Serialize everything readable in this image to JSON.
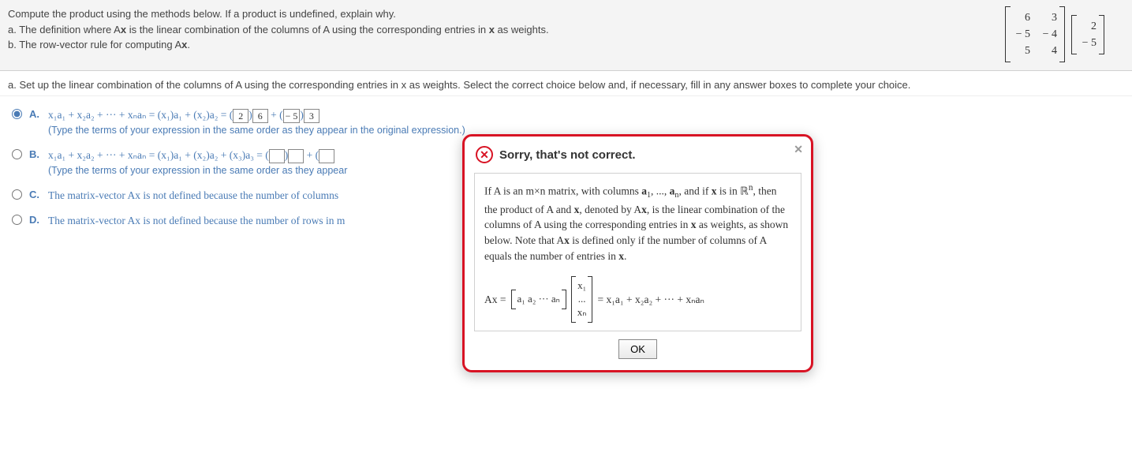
{
  "header": {
    "line1": "Compute the product using the methods below. If a product is undefined, explain why.",
    "line2_prefix": "a. The definition where A",
    "line2_mid": " is the linear combination of the columns of A using the corresponding entries in ",
    "line2_suffix": " as weights.",
    "line3_prefix": "b. The row-vector rule for computing A",
    "line3_suffix": "."
  },
  "matrixA": [
    [
      "6",
      "3"
    ],
    [
      "− 5",
      "− 4"
    ],
    [
      "5",
      "4"
    ]
  ],
  "vectorX": [
    [
      "2"
    ],
    [
      "− 5"
    ]
  ],
  "subtitle": "a. Set up the linear combination of the columns of A using the corresponding entries in x as weights. Select the correct choice below and, if necessary, fill in any answer boxes to complete your choice.",
  "choices": {
    "A": {
      "letter": "A.",
      "expr_pre": "x₁a₁ + x₂a₂ + ··· + xₙaₙ = (x₁)a₁ + (x₂)a₂ = (",
      "val1": "2",
      "mid1": ")",
      "val2": "6",
      "plus": " + (",
      "val3": "− 5",
      "mid2": ")",
      "val4": "3",
      "hint": "(Type the terms of your expression in the same order as they appear in the original expression.)"
    },
    "B": {
      "letter": "B.",
      "expr": "x₁a₁ + x₂a₂ + ··· + xₙaₙ = (x₁)a₁ + (x₂)a₂ + (x₃)a₃ = (",
      "mid1": ")",
      "plus": " + (",
      "hint": "(Type the terms of your expression in the same order as they appear"
    },
    "C": {
      "letter": "C.",
      "text": "The matrix-vector Ax is not defined because the number of columns"
    },
    "D": {
      "letter": "D.",
      "text": "The matrix-vector Ax is not defined because the number of rows in m"
    }
  },
  "modal": {
    "title": "Sorry, that's not correct.",
    "close": "✕",
    "body1": "If A is an m×n matrix, with columns ",
    "body2": ", ..., ",
    "body3": ", and if ",
    "body4": " is in ",
    "body5": ", then the product of A and ",
    "body6": ", denoted by A",
    "body7": ", is the linear combination of the columns of A using the corresponding entries in ",
    "body8": " as weights, as shown below. Note that A",
    "body9": " is defined only if the number of columns of A equals the number of entries in ",
    "body10": ".",
    "eq_lhs": "Ax =",
    "eq_row": "a₁  a₂  ···  aₙ",
    "eq_v1": "x₁",
    "eq_vdots": "...",
    "eq_vn": "xₙ",
    "eq_rhs": "= x₁a₁ + x₂a₂ + ··· + xₙaₙ",
    "ok": "OK"
  }
}
